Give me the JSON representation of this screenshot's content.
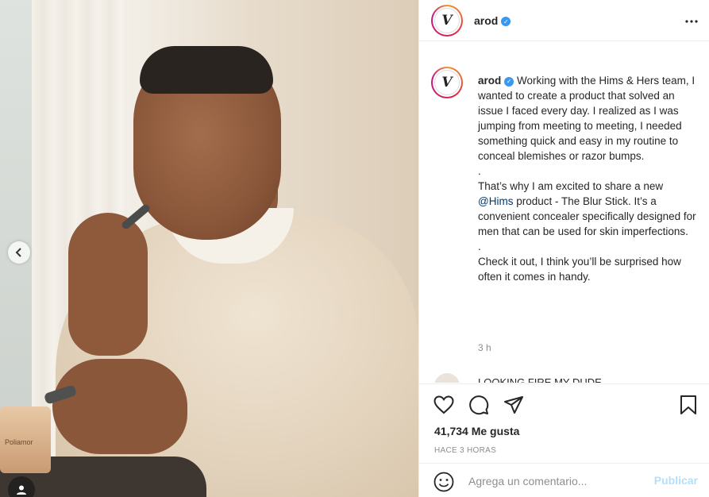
{
  "photo": {
    "jar_label": "Poliamor"
  },
  "post": {
    "username": "arod",
    "avatar_glyph": "V",
    "caption_lines": [
      "Working with the Hims & Hers team, I wanted to create a product that solved an issue I faced every day. I realized as I was jumping from meeting to meeting, I needed something quick and easy in my routine to conceal blemishes or razor bumps.",
      ".",
      "That’s why I am excited to share a new ",
      "@Hims",
      " product - The Blur Stick. It’s a convenient concealer specifically designed for men that can be used for skin imperfections.",
      ".",
      "Check it out, I think you’ll be surprised how often it comes in handy."
    ],
    "time": "3 h",
    "next_comment": "LOOKING FIRE MY DUDE",
    "likes": "41,734 Me gusta",
    "ago": "Hace 3 horas"
  },
  "comment_box": {
    "placeholder": "Agrega un comentario...",
    "post_label": "Publicar"
  },
  "colors": {
    "verified": "#3897f0",
    "mention": "#00376b",
    "post_button_disabled": "#b2dffc",
    "muted": "#8e8e8e"
  },
  "icons": [
    "previous-arrow-icon",
    "user-tag-icon",
    "verified-icon",
    "more-options-icon",
    "heart-icon",
    "comment-icon",
    "share-icon",
    "bookmark-icon",
    "emoji-icon"
  ]
}
